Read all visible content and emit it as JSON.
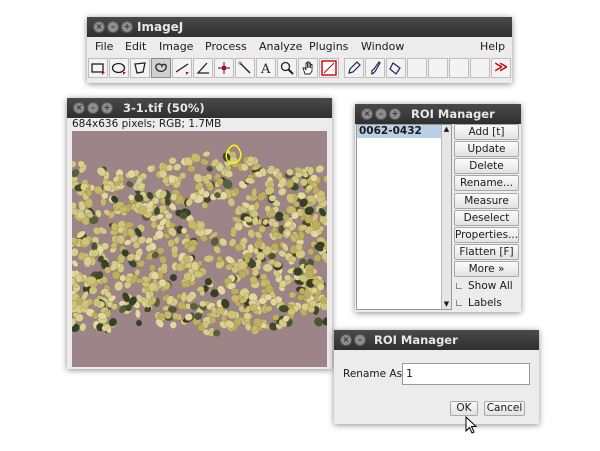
{
  "imagej": {
    "title": "ImageJ",
    "menus": [
      {
        "label": "File"
      },
      {
        "label": "Edit"
      },
      {
        "label": "Image"
      },
      {
        "label": "Process"
      },
      {
        "label": "Analyze"
      },
      {
        "label": "Plugins"
      },
      {
        "label": "Window"
      },
      {
        "label": "Help"
      }
    ],
    "tools": [
      {
        "icon": "rectangle-tool-icon"
      },
      {
        "icon": "oval-tool-icon"
      },
      {
        "icon": "polygon-tool-icon"
      },
      {
        "icon": "freehand-tool-icon"
      },
      {
        "icon": "straight-line-tool-icon"
      },
      {
        "icon": "angle-tool-icon"
      },
      {
        "icon": "point-tool-icon"
      },
      {
        "icon": "wand-tool-icon"
      },
      {
        "icon": "text-tool-icon"
      },
      {
        "icon": "magnifier-tool-icon"
      },
      {
        "icon": "hand-tool-icon"
      },
      {
        "icon": "color-picker-tool-icon"
      },
      {
        "icon": "pencil-tool-icon"
      },
      {
        "icon": "brush-tool-icon"
      },
      {
        "icon": "flood-fill-tool-icon"
      },
      {
        "icon": "more-tools-icon",
        "label": "≫"
      }
    ],
    "selected_tool": "freehand-tool-icon"
  },
  "image_window": {
    "title": "3-1.tif (50%)",
    "info": "684x636 pixels; RGB; 1.7MB"
  },
  "roi_manager": {
    "title": "ROI Manager",
    "list": [
      "0062-0432"
    ],
    "selected_index": 0,
    "buttons": [
      "Add [t]",
      "Update",
      "Delete",
      "Rename...",
      "Measure",
      "Deselect",
      "Properties...",
      "Flatten [F]",
      "More »"
    ],
    "checkboxes": [
      {
        "label": "Show All",
        "checked": false
      },
      {
        "label": "Labels",
        "checked": false
      }
    ]
  },
  "rename_dialog": {
    "title": "ROI Manager",
    "field_label": "Rename As:",
    "field_value": "1",
    "ok_label": "OK",
    "cancel_label": "Cancel"
  },
  "colors": {
    "titlebar": "#333333",
    "selection": "#b8cfe6",
    "roi_outline": "#ffff00",
    "image_background": "#9c8489"
  }
}
